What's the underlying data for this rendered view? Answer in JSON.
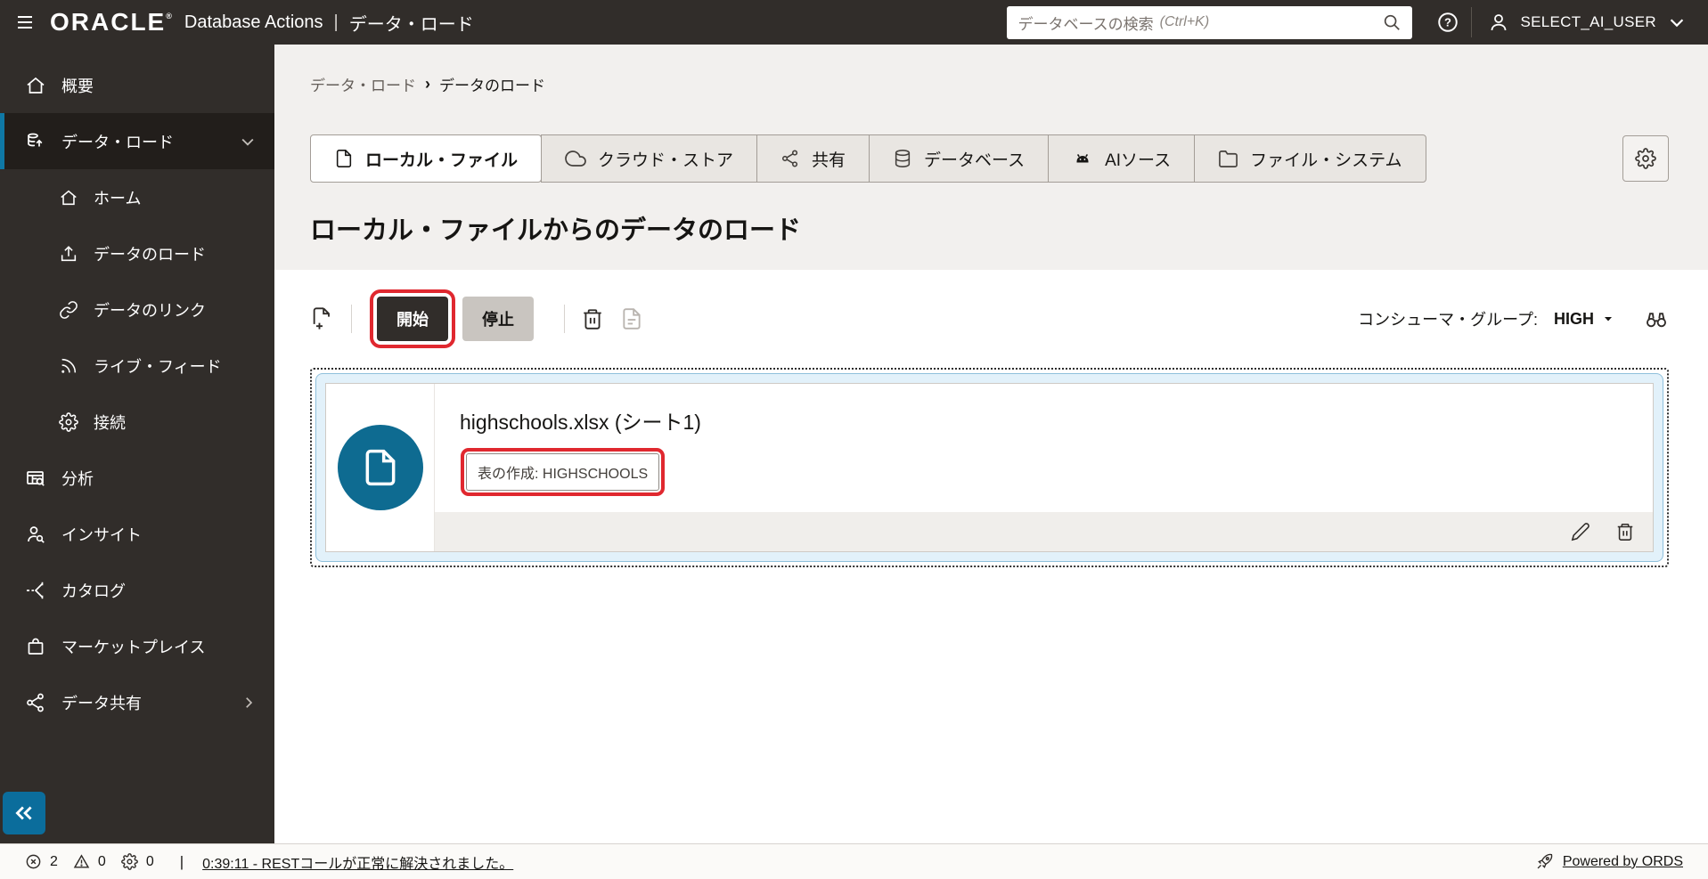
{
  "header": {
    "logo": "ORACLE",
    "logo_mark": "®",
    "app_title": "Database Actions",
    "pipe": "|",
    "context": "データ・ロード",
    "search_placeholder": "データベースの検索",
    "search_shortcut_hint": "(Ctrl+K)",
    "user": "SELECT_AI_USER"
  },
  "sidebar": {
    "items": [
      {
        "label": "概要"
      },
      {
        "label": "データ・ロード"
      },
      {
        "label": "ホーム"
      },
      {
        "label": "データのロード"
      },
      {
        "label": "データのリンク"
      },
      {
        "label": "ライブ・フィード"
      },
      {
        "label": "接続"
      },
      {
        "label": "分析"
      },
      {
        "label": "インサイト"
      },
      {
        "label": "カタログ"
      },
      {
        "label": "マーケットプレイス"
      },
      {
        "label": "データ共有"
      }
    ]
  },
  "breadcrumb": {
    "parent": "データ・ロード",
    "separator": "›",
    "current": "データのロード"
  },
  "tabs": [
    {
      "label": "ローカル・ファイル"
    },
    {
      "label": "クラウド・ストア"
    },
    {
      "label": "共有"
    },
    {
      "label": "データベース"
    },
    {
      "label": "AIソース"
    },
    {
      "label": "ファイル・システム"
    }
  ],
  "page": {
    "title": "ローカル・ファイルからのデータのロード"
  },
  "toolbar": {
    "start_label": "開始",
    "stop_label": "停止",
    "consumer_group_label": "コンシューマ・グループ:",
    "consumer_group_value": "HIGH"
  },
  "file_card": {
    "title": "highschools.xlsx (シート1)",
    "chip": "表の作成: HIGHSCHOOLS"
  },
  "status_bar": {
    "errors": "2",
    "warnings": "0",
    "jobs": "0",
    "pipe": "|",
    "message": "0:39:11 - RESTコールが正常に解決されました。",
    "ords": "Powered by ORDS"
  },
  "colors": {
    "header_bg": "#312d2a",
    "accent_teal": "#0b6d9c",
    "annotation_red": "#e0282f"
  }
}
